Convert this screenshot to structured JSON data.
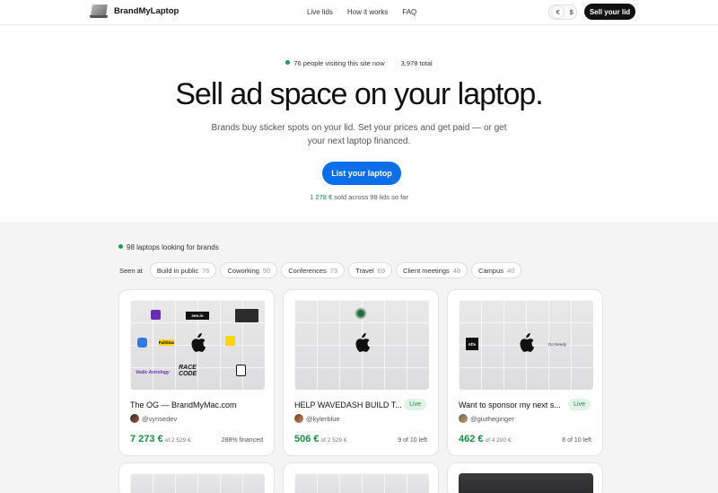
{
  "nav": {
    "brand": "BrandMyLaptop",
    "links": [
      "Live lids",
      "How it works",
      "FAQ"
    ],
    "currency": [
      "€",
      "$"
    ],
    "sell_label": "Sell your lid"
  },
  "hero": {
    "visiting": "76 people visiting this site now",
    "total": "3,978 total",
    "title": "Sell ad space on your laptop.",
    "subtitle": "Brands buy sticker spots on your lid. Set your prices and get paid — or get your next laptop financed.",
    "cta": "List your laptop",
    "sold_amount": "1 278 €",
    "sold_rest": " sold across 98 lids so far"
  },
  "listings": {
    "count": "98 laptops looking for brands",
    "seen_at": "Seen at",
    "filters": [
      {
        "label": "Build in public",
        "count": "76"
      },
      {
        "label": "Coworking",
        "count": "90"
      },
      {
        "label": "Conferences",
        "count": "73"
      },
      {
        "label": "Travel",
        "count": "69"
      },
      {
        "label": "Client meetings",
        "count": "48"
      },
      {
        "label": "Campus",
        "count": "40"
      }
    ],
    "cards": [
      {
        "title": "The OG — BrandMyMac.com",
        "user": "@vynsedev",
        "price": "7 273 €",
        "of": "of 2 529 €",
        "meta": "288% financed",
        "live": ""
      },
      {
        "title": "HELP WAVEDASH BUILD T...",
        "user": "@kylerblue",
        "price": "506 €",
        "of": "of 2 529 €",
        "meta": "9 of 10 left",
        "live": "Live"
      },
      {
        "title": "Want to sponsor my next s...",
        "user": "@giutheginger",
        "price": "462 €",
        "of": "of 4 200 €",
        "meta": "8 of 10 left",
        "live": "Live"
      }
    ],
    "stickers": {
      "seo": "seo.io",
      "fullstax": "FullStax",
      "vedic": "Vedic Astrology",
      "race": "RACE CODE",
      "afts": "Afts",
      "goneedy": "Go Needy"
    }
  }
}
